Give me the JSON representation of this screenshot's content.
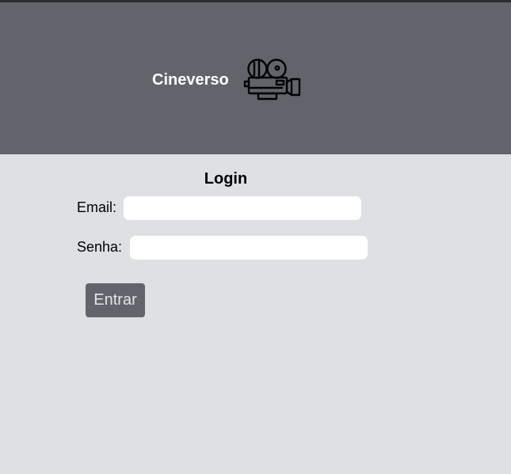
{
  "header": {
    "brand": "Cineverso",
    "icon": "movie-camera-icon",
    "background_color": "#61646b"
  },
  "login": {
    "title": "Login",
    "email_label": "Email:",
    "email_value": "",
    "password_label": "Senha:",
    "password_value": "",
    "submit_label": "Entrar"
  },
  "colors": {
    "page_background": "#dee0e4",
    "button_background": "#61646b",
    "button_text": "#e4e6ea"
  }
}
